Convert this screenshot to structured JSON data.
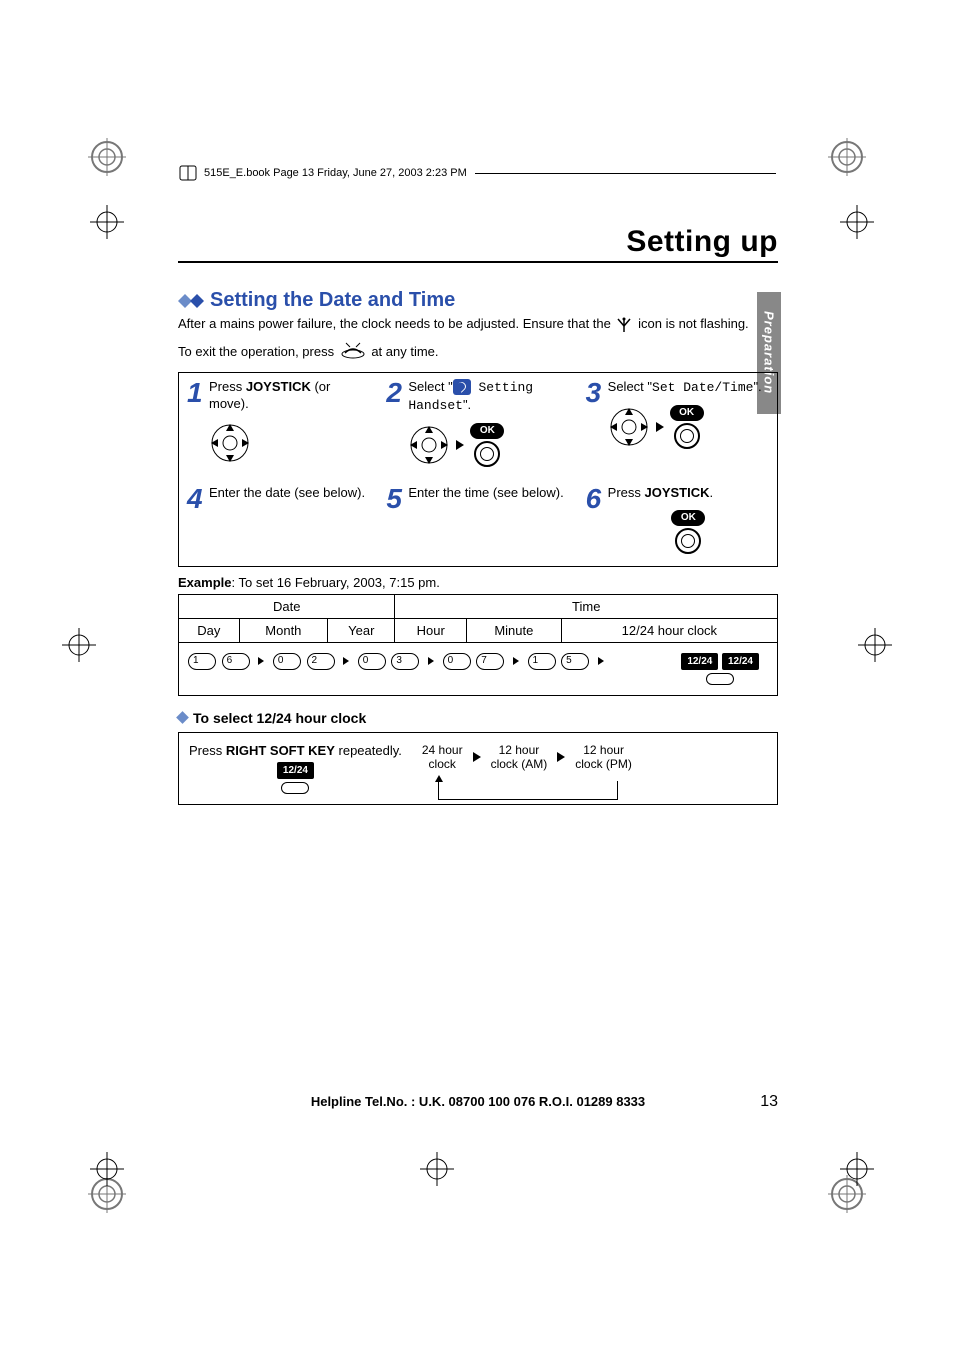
{
  "header": {
    "runhead": "515E_E.book  Page 13  Friday, June 27, 2003  2:23 PM"
  },
  "title": "Setting up",
  "side_tab": "Preparation",
  "section": {
    "heading": "Setting the Date and Time",
    "body1_a": "After a mains power failure, the clock needs to be adjusted. Ensure that the ",
    "body1_b": " icon is not flashing.",
    "body2_a": "To exit the operation, press ",
    "body2_b": " at any time."
  },
  "steps": [
    {
      "num": "1",
      "text_a": "Press ",
      "bold": "JOYSTICK",
      "text_b": " (or move)."
    },
    {
      "num": "2",
      "text_a": "Select \"",
      "mono": " Setting Handset",
      "text_b": "\"."
    },
    {
      "num": "3",
      "text_a": "Select \"",
      "mono": "Set Date/Time",
      "text_b": "\"."
    },
    {
      "num": "4",
      "text_a": "Enter the date (see below)."
    },
    {
      "num": "5",
      "text_a": "Enter the time (see below)."
    },
    {
      "num": "6",
      "text_a": "Press ",
      "bold": "JOYSTICK",
      "text_b": "."
    }
  ],
  "ok_label": "OK",
  "example_intro_bold": "Example",
  "example_intro": ": To set 16 February, 2003, 7:15 pm.",
  "table": {
    "date": "Date",
    "time": "Time",
    "day": "Day",
    "month": "Month",
    "year": "Year",
    "hour": "Hour",
    "minute": "Minute",
    "clock": "12/24 hour clock",
    "keys": {
      "day": [
        "1",
        "6"
      ],
      "month": [
        "0",
        "2"
      ],
      "year": [
        "0",
        "3"
      ],
      "hour": [
        "0",
        "7"
      ],
      "minute": [
        "1",
        "5"
      ],
      "clock_tag": "12/24"
    }
  },
  "clock_section": {
    "heading": "To select 12/24 hour clock",
    "press_a": "Press ",
    "press_bold": "RIGHT SOFT KEY",
    "press_b": " repeatedly.",
    "tag": "12/24",
    "opt1a": "24 hour",
    "opt1b": "clock",
    "opt2a": "12 hour",
    "opt2b": "clock (AM)",
    "opt3a": "12 hour",
    "opt3b": "clock (PM)"
  },
  "footer": {
    "helpline": "Helpline Tel.No. : U.K. 08700 100 076  R.O.I. 01289 8333",
    "page": "13"
  }
}
